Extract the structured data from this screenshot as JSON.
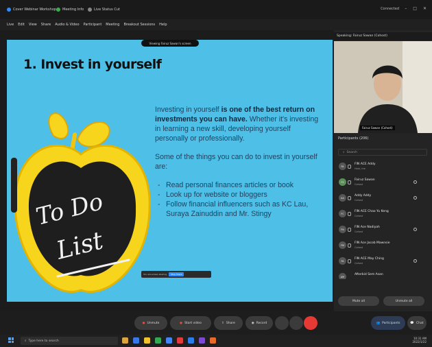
{
  "titlebar": {
    "tabs": [
      "Cover Webinar Workshop 1",
      "Meeting Info",
      "Live Status Cut"
    ],
    "connected": "Connected"
  },
  "menubar": {
    "items": [
      "Live",
      "Edit",
      "View",
      "Share",
      "Audio & Video",
      "Participant",
      "Meeting",
      "Breakout Sessions",
      "Help"
    ]
  },
  "viewing_label": "Viewing Fairuz Sawan's screen",
  "slide": {
    "title": "1. Invest in yourself",
    "para1_a": "Investing in yourself ",
    "para1_b": "is one of the best return on investments you can have.",
    "para1_c": " Whether it's investing in learning a new skill, developing yourself personally or professionally.",
    "para2": "Some of the things you can do to invest in yourself are:",
    "bullets": [
      "Read personal finances articles or book",
      "Look up for website or bloggers",
      "Follow financial influencers such as KC Lau, Suraya Zainuddin and Mr. Stingy"
    ],
    "chalk_line1": "To Do",
    "chalk_line2": "List",
    "share_banner": "You are screen sharing",
    "share_stop": "Stop Share"
  },
  "panel": {
    "speaking": "Speaking: Fairuz Sawan (Cohost)",
    "video_name": "Fairuz Sawan (Cohost)",
    "participants_header": "Participants (206)",
    "search_placeholder": "Search",
    "participants": [
      {
        "initials": "FA",
        "name": "FIN ACE Addy",
        "role": "Host, me"
      },
      {
        "initials": "FS",
        "name": "Fairuz Sawan",
        "role": "Cohost"
      },
      {
        "initials": "AA",
        "name": "Addy Addy",
        "role": "Cohost"
      },
      {
        "initials": "FC",
        "name": "FIN ACE Chao Yu Keng",
        "role": "Cohost"
      },
      {
        "initials": "FN",
        "name": "FIN Ace Nadiyah",
        "role": "Cohost"
      },
      {
        "initials": "FM",
        "name": "FIN Ace Jacob Mawnsie",
        "role": "Cohost"
      },
      {
        "initials": "FA",
        "name": "FIN ACE May Ching",
        "role": "Cohost"
      },
      {
        "initials": "AM",
        "name": "Afterbid Sem Asan",
        "role": ""
      }
    ],
    "mute_all": "Mute all",
    "unmute_all": "Unmute all"
  },
  "controls": {
    "unmute": "Unmute",
    "start_video": "Start video",
    "share": "Share",
    "record": "Record",
    "participants": "Participants",
    "chat": "Chat"
  },
  "taskbar": {
    "search_placeholder": "Type here to search",
    "time": "10:31 AM",
    "date": "2022/1/22",
    "icon_colors": [
      "#d9a441",
      "#3b78e7",
      "#f2c12e",
      "#34a853",
      "#4285f4",
      "#e23c3c",
      "#2b7de9",
      "#7b4ad0",
      "#e76a2a"
    ]
  }
}
